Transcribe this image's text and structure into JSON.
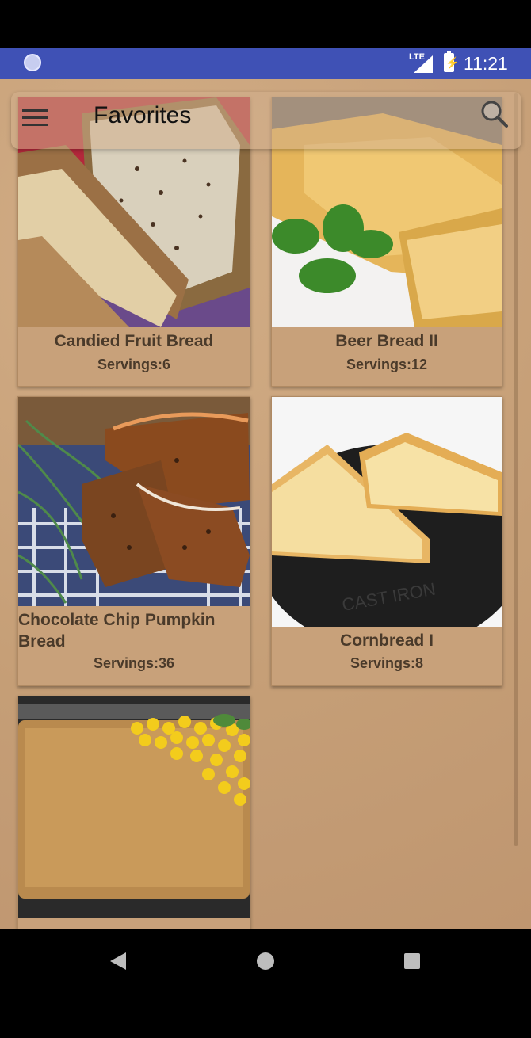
{
  "status_bar": {
    "network": "LTE",
    "time": "11:21"
  },
  "toolbar": {
    "title": "Favorites"
  },
  "recipes": [
    {
      "name": "Candied Fruit Bread",
      "servings": "Servings:6"
    },
    {
      "name": "Beer Bread II",
      "servings": "Servings:12"
    },
    {
      "name": "Chocolate Chip Pumpkin Bread",
      "servings": "Servings:36"
    },
    {
      "name": "Cornbread I",
      "servings": "Servings:8"
    }
  ],
  "colors": {
    "status_bar": "#3f51b5",
    "background": "#c9a27a",
    "card_text": "#4a3a2a"
  }
}
